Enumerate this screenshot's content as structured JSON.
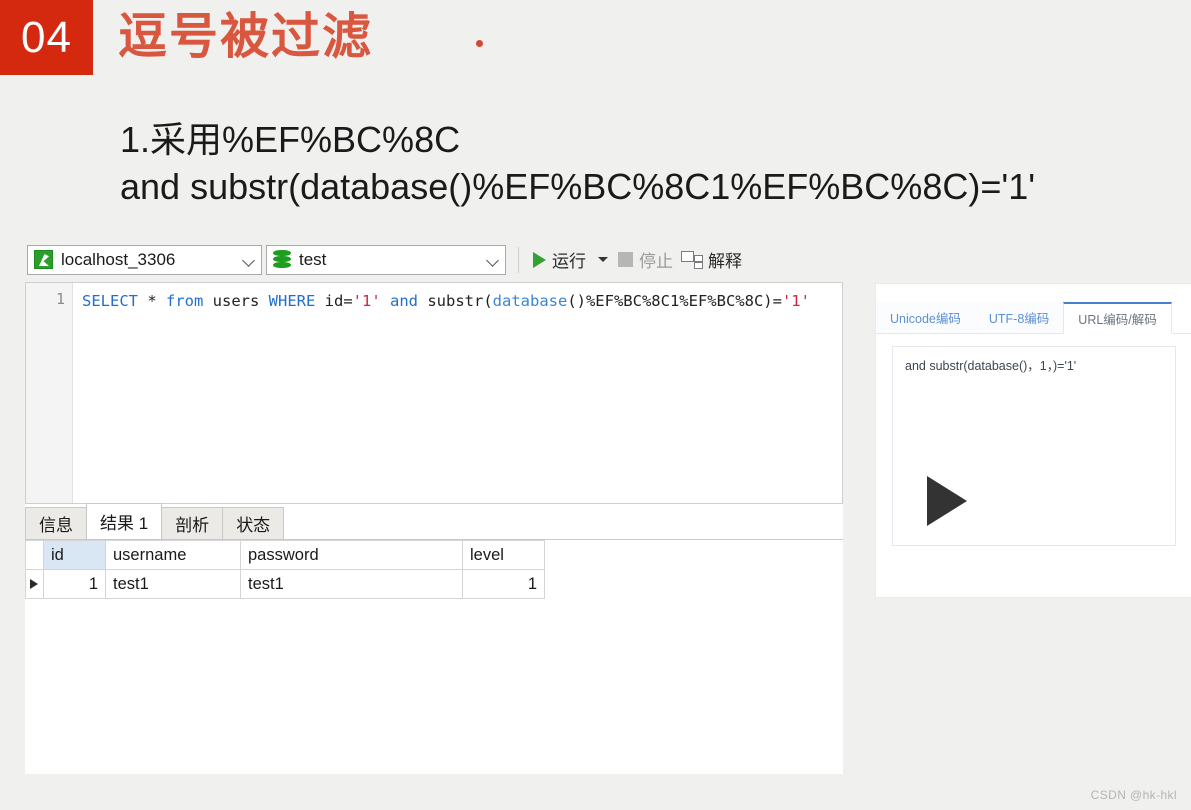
{
  "slide": {
    "number": "04",
    "title": "逗号被过滤",
    "accent_red": "#d4280f",
    "title_red": "#d9563f",
    "body_lines": [
      "1.采用%EF%BC%8C",
      "and substr(database()%EF%BC%8C1%EF%BC%8C)='1'"
    ]
  },
  "navicat": {
    "toolbar": {
      "connection": "localhost_3306",
      "database": "test",
      "run_label": "运行",
      "stop_label": "停止",
      "explain_label": "解释"
    },
    "editor": {
      "line_number": "1",
      "sql_tokens": [
        {
          "t": "SELECT",
          "c": "kw"
        },
        {
          "t": " * ",
          "c": ""
        },
        {
          "t": "from",
          "c": "kw"
        },
        {
          "t": " users ",
          "c": ""
        },
        {
          "t": "WHERE",
          "c": "kw"
        },
        {
          "t": " id=",
          "c": ""
        },
        {
          "t": "'1'",
          "c": "str"
        },
        {
          "t": " ",
          "c": ""
        },
        {
          "t": "and",
          "c": "kw"
        },
        {
          "t": " substr(",
          "c": ""
        },
        {
          "t": "database",
          "c": "fn"
        },
        {
          "t": "()%EF%BC%8C1%EF%BC%8C)=",
          "c": ""
        },
        {
          "t": "'1'",
          "c": "str"
        }
      ],
      "sql_plain": "SELECT * from users WHERE id='1' and substr(database()%EF%BC%8C1%EF%BC%8C)='1'"
    },
    "result_tabs": [
      {
        "label": "信息",
        "active": false
      },
      {
        "label": "结果 1",
        "active": true
      },
      {
        "label": "剖析",
        "active": false
      },
      {
        "label": "状态",
        "active": false
      }
    ],
    "result_grid": {
      "columns": [
        "id",
        "username",
        "password",
        "level"
      ],
      "rows": [
        {
          "id": "1",
          "username": "test1",
          "password": "test1",
          "level": "1"
        }
      ]
    }
  },
  "encoder": {
    "tabs": [
      {
        "label": "Unicode编码",
        "active": false
      },
      {
        "label": "UTF-8编码",
        "active": false
      },
      {
        "label": "URL编码/解码",
        "active": true
      }
    ],
    "content": "and substr(database()，1，)='1'"
  },
  "watermark": "CSDN @hk-hkl"
}
